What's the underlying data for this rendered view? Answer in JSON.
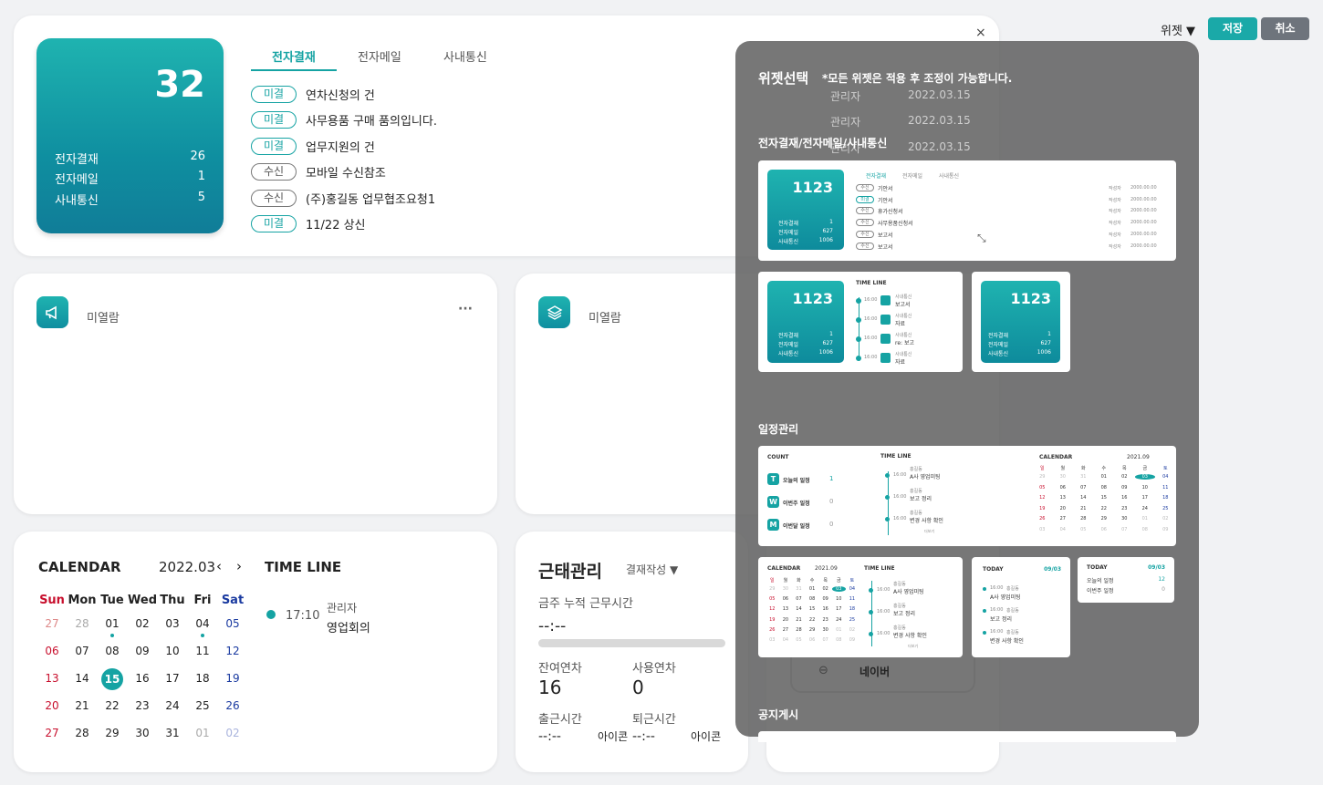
{
  "toolbar": {
    "widget_label": "위젯 ▼",
    "save_label": "저장",
    "cancel_label": "취소",
    "close_label": "×"
  },
  "approval": {
    "total": "32",
    "stats": [
      {
        "label": "전자결재",
        "value": "26"
      },
      {
        "label": "전자메일",
        "value": "1"
      },
      {
        "label": "사내통신",
        "value": "5"
      }
    ],
    "tabs": [
      "전자결재",
      "전자메일",
      "사내통신"
    ],
    "items": [
      {
        "badge": "미결",
        "title": "연차신청의 건",
        "author": "관리자",
        "date": "2022.03.15"
      },
      {
        "badge": "미결",
        "title": "사무용품 구매 품의입니다.",
        "author": "관리자",
        "date": "2022.03.15"
      },
      {
        "badge": "미결",
        "title": "업무지원의 건",
        "author": "관리자",
        "date": "2022.03.15"
      },
      {
        "badge": "수신",
        "title": "모바일 수신참조"
      },
      {
        "badge": "수신",
        "title": "(주)홍길동 업무협조요청1"
      },
      {
        "badge": "미결",
        "title": "11/22 상신"
      }
    ]
  },
  "notice_widget": {
    "label": "미열람",
    "more": "···"
  },
  "layers_widget": {
    "label": "미열람"
  },
  "calendar": {
    "title": "CALENDAR",
    "month": "2022.03",
    "weekdays": [
      "Sun",
      "Mon",
      "Tue",
      "Wed",
      "Thu",
      "Fri",
      "Sat"
    ],
    "weeks": [
      [
        "27",
        "28",
        "01",
        "02",
        "03",
        "04",
        "05"
      ],
      [
        "06",
        "07",
        "08",
        "09",
        "10",
        "11",
        "12"
      ],
      [
        "13",
        "14",
        "15",
        "16",
        "17",
        "18",
        "19"
      ],
      [
        "20",
        "21",
        "22",
        "23",
        "24",
        "25",
        "26"
      ],
      [
        "27",
        "28",
        "29",
        "30",
        "31",
        "01",
        "02"
      ]
    ]
  },
  "timeline": {
    "title": "TIME LINE",
    "time": "17:10",
    "who": "관리자",
    "what": "영업회의"
  },
  "attendance": {
    "title": "근태관리",
    "approval_btn": "결재작성 ▼",
    "weekly_label": "금주 누적 근무시간",
    "weekly_value": "--:--",
    "remaining_label": "잔여연차",
    "remaining_value": "16",
    "used_label": "사용연차",
    "used_value": "0",
    "in_label": "출근시간",
    "in_value": "--:--",
    "in_icon": "아이콘",
    "out_label": "퇴근시간",
    "out_value": "--:--",
    "out_icon": "아이콘"
  },
  "link": {
    "label": "네이버"
  },
  "panel": {
    "title": "위젯선택",
    "note": "*모든 위젯은 적용 후 조정이 가능합니다.",
    "section1": "전자결재/전자메일/사내통신",
    "section2": "일정관리",
    "section3": "공지게시",
    "thumb_num": "1123",
    "thumb_stats": [
      {
        "label": "전자결재",
        "value": "1"
      },
      {
        "label": "전자메일",
        "value": "627"
      },
      {
        "label": "사내통신",
        "value": "1006"
      }
    ],
    "thumb_tabs": [
      "전자결재",
      "전자메일",
      "사내통신"
    ],
    "thumb_rows": [
      {
        "b": "수신",
        "t": "기안서"
      },
      {
        "b": "미결",
        "t": "기안서"
      },
      {
        "b": "수신",
        "t": "휴가신청서"
      },
      {
        "b": "수신",
        "t": "사무용품신청서"
      },
      {
        "b": "수신",
        "t": "보고서"
      },
      {
        "b": "수신",
        "t": "보고서"
      }
    ],
    "thumb_author": "작성자",
    "thumb_date": "2000.00.00",
    "timeline_label": "TIME LINE",
    "tl_items": [
      {
        "time": "16:00",
        "cat": "사내통신",
        "t": "보고서"
      },
      {
        "time": "16:00",
        "cat": "사내통신",
        "t": "자료"
      },
      {
        "time": "16:00",
        "cat": "사내통신",
        "t": "re: 보고"
      },
      {
        "time": "16:00",
        "cat": "사내통신",
        "t": "자료"
      }
    ],
    "count_label": "COUNT",
    "calendar_label": "CALENDAR",
    "cal_month": "2021.09",
    "counts": [
      {
        "k": "T",
        "label": "오늘의 일정",
        "v": "1"
      },
      {
        "k": "W",
        "label": "이번주 일정",
        "v": "0"
      },
      {
        "k": "M",
        "label": "이번달 일정",
        "v": "0"
      }
    ],
    "sched": [
      {
        "time": "16:00",
        "who": "홍길동",
        "t": "A사 영업미팅"
      },
      {
        "time": "16:00",
        "who": "홍길동",
        "t": "보고 정리"
      },
      {
        "time": "16:00",
        "who": "홍길동",
        "t": "변경 사항 확인"
      }
    ],
    "more": "더보기",
    "today_label": "TODAY",
    "today_date": "09/03",
    "today_counts": [
      {
        "label": "오늘의 일정",
        "v": "12"
      },
      {
        "label": "이번주 일정",
        "v": "0"
      }
    ]
  }
}
